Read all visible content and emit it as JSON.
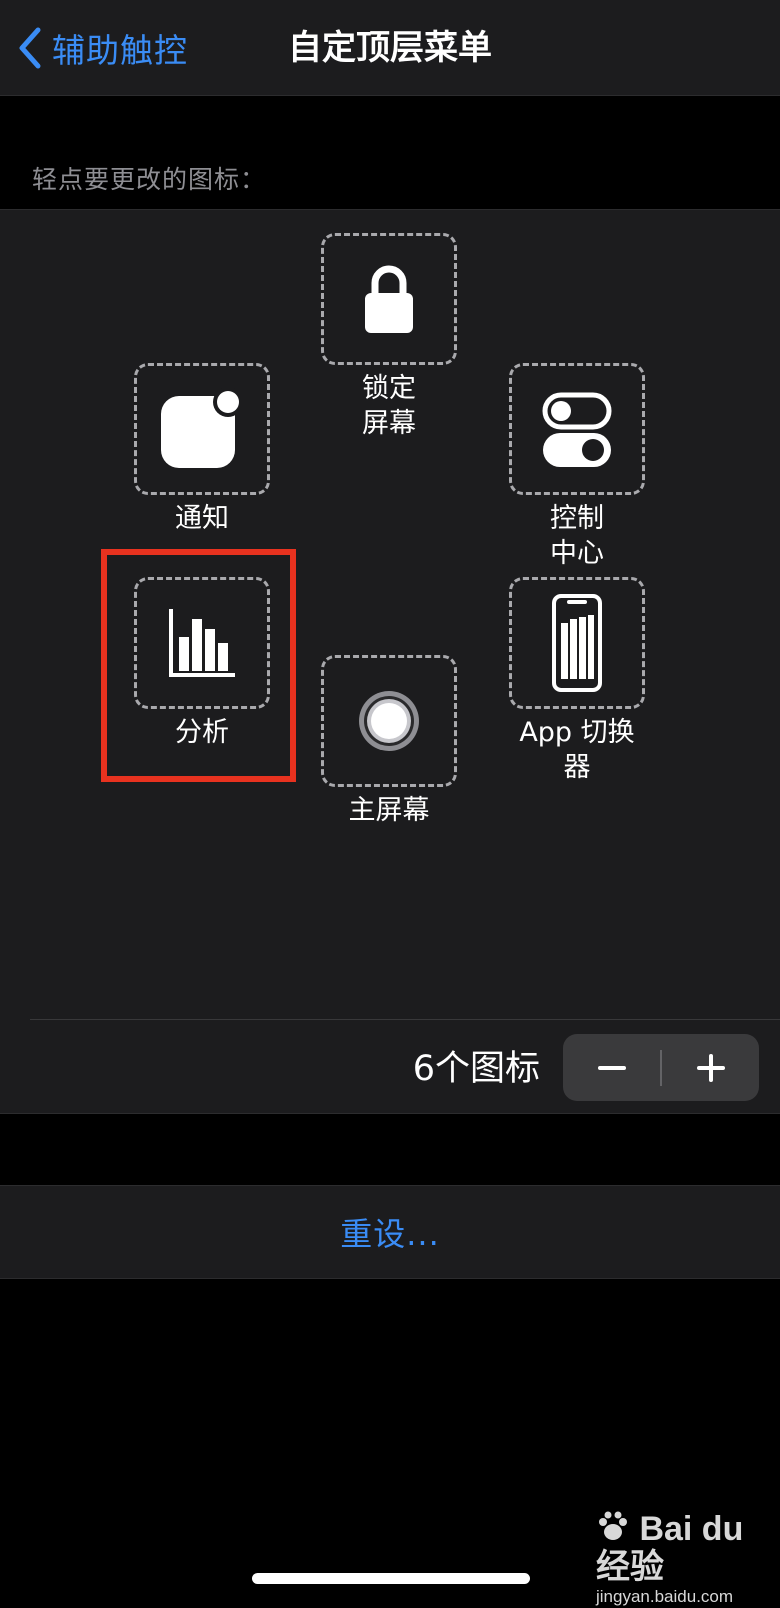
{
  "nav": {
    "back_label": "辅助触控",
    "title": "自定顶层菜单"
  },
  "section_header": "轻点要更改的图标：",
  "menu_items": [
    {
      "label": "锁定\n屏幕",
      "icon": "lock-icon"
    },
    {
      "label": "通知",
      "icon": "notification-icon"
    },
    {
      "label": "控制\n中心",
      "icon": "toggles-icon"
    },
    {
      "label": "分析",
      "icon": "bar-chart-icon",
      "highlighted": true
    },
    {
      "label": "主屏幕",
      "icon": "home-button-icon"
    },
    {
      "label": "App 切换器",
      "icon": "app-switcher-icon"
    }
  ],
  "footer": {
    "icon_count": "6个图标"
  },
  "reset_label": "重设...",
  "watermark": {
    "logo": "Bai du 经验",
    "url": "jingyan.baidu.com"
  },
  "colors": {
    "accent": "#3a8cf5",
    "highlight": "#e8321f",
    "panel": "#1c1c1e"
  }
}
